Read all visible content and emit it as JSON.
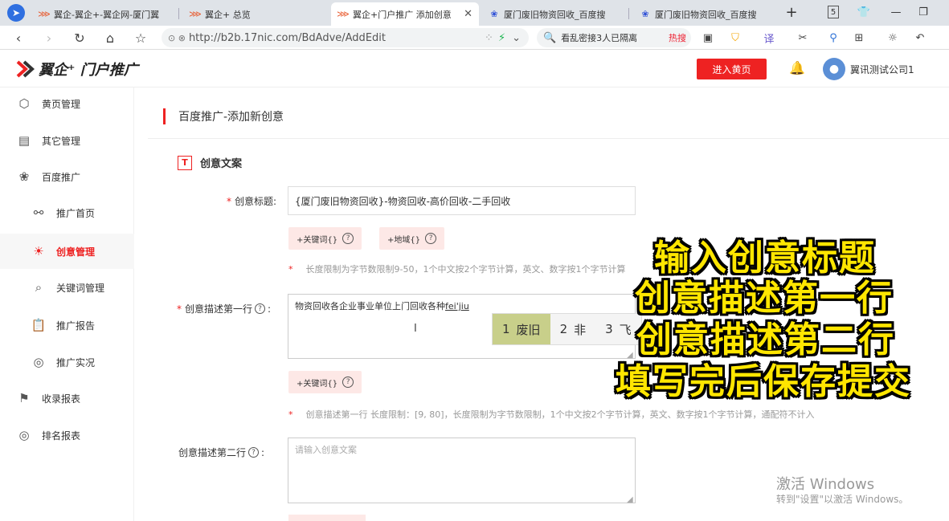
{
  "browser": {
    "tabs": [
      {
        "label": "翼企-翼企+-翼企网-厦门翼",
        "icon": "logo-icon"
      },
      {
        "label": "翼企+ 总览",
        "icon": "logo-icon"
      },
      {
        "label": "翼企+门户推广 添加创意",
        "icon": "logo-icon",
        "active": true
      },
      {
        "label": "厦门废旧物资回收_百度搜",
        "icon": "baidu-icon"
      },
      {
        "label": "厦门废旧物资回收_百度搜",
        "icon": "baidu-icon"
      }
    ],
    "new_tab": "+",
    "tab_count": "5",
    "url": "http://b2b.17nic.com/BdAdve/AddEdit",
    "search_text": "看乱密接3人已隔离",
    "hot_label": "热搜"
  },
  "app": {
    "logo_text": "翼企⁺ 门户推广",
    "enter_button": "进入黄页",
    "company_name": "翼讯测试公司1"
  },
  "sidebar": {
    "items": [
      {
        "label": "黄页管理",
        "icon": "cube-icon"
      },
      {
        "label": "其它管理",
        "icon": "document-icon"
      },
      {
        "label": "百度推广",
        "icon": "paw-icon"
      },
      {
        "label": "推广首页",
        "icon": "share-icon"
      },
      {
        "label": "创意管理",
        "icon": "bulb-icon",
        "active": true
      },
      {
        "label": "关键词管理",
        "icon": "search-icon"
      },
      {
        "label": "推广报告",
        "icon": "clipboard-icon"
      },
      {
        "label": "推广实况",
        "icon": "target-icon"
      },
      {
        "label": "收录报表",
        "icon": "bookmark-icon"
      },
      {
        "label": "排名报表",
        "icon": "target-icon"
      }
    ]
  },
  "main": {
    "page_title": "百度推广-添加新创意",
    "section_title": "创意文案",
    "section_icon_letter": "T",
    "title_label": "创意标题:",
    "title_value": "{厦门废旧物资回收}-物资回收-高价回收-二手回收",
    "tag_keyword": "+关键词{}",
    "tag_region": "+地域{}",
    "hint1": "长度限制为字节数限制9-50，1个中文按2个字节计算，英文、数字按1个字节计算",
    "desc1_label": "创意描述第一行",
    "desc1_value": "物资回收各企业事业单位上门回收各种",
    "desc1_pinyin": "fei'jiu",
    "hint2": "创意描述第一行 长度限制：[9, 80]，长度限制为字节数限制，1个中文按2个字节计算，英文、数字按1个字节计算，通配符不计入",
    "desc2_label": "创意描述第二行",
    "desc2_placeholder": "请输入创意文案"
  },
  "ime": {
    "candidates": [
      {
        "n": "1",
        "word": "废旧"
      },
      {
        "n": "2",
        "word": "非"
      },
      {
        "n": "3",
        "word": "飞"
      }
    ]
  },
  "overlay": {
    "lines": [
      "输入创意标题",
      "创意描述第一行",
      "创意描述第二行",
      "填写完后保存提交"
    ]
  },
  "watermark": {
    "line1": "激活 Windows",
    "line2": "转到\"设置\"以激活 Windows。"
  }
}
